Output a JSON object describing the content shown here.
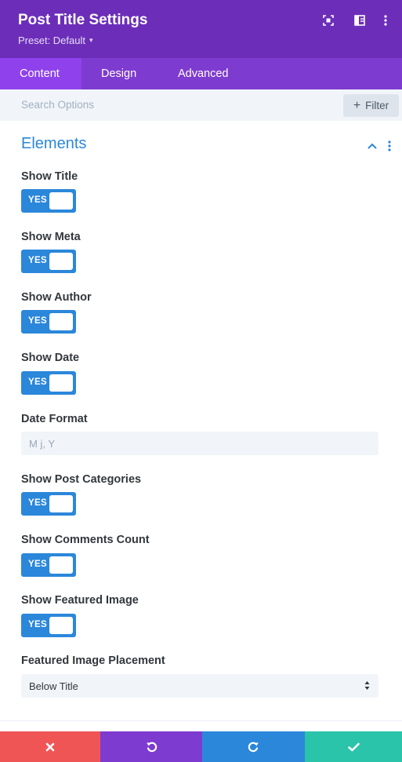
{
  "header": {
    "title": "Post Title Settings",
    "preset": "Preset: Default",
    "icons": [
      "expand-icon",
      "split-view-icon",
      "more-options-icon"
    ]
  },
  "tabs": [
    {
      "label": "Content",
      "active": true
    },
    {
      "label": "Design",
      "active": false
    },
    {
      "label": "Advanced",
      "active": false
    }
  ],
  "search": {
    "placeholder": "Search Options",
    "filter_label": "Filter"
  },
  "section": {
    "title": "Elements"
  },
  "fields": {
    "show_title": {
      "label": "Show Title",
      "value": "YES"
    },
    "show_meta": {
      "label": "Show Meta",
      "value": "YES"
    },
    "show_author": {
      "label": "Show Author",
      "value": "YES"
    },
    "show_date": {
      "label": "Show Date",
      "value": "YES"
    },
    "date_format": {
      "label": "Date Format",
      "placeholder": "M j, Y"
    },
    "show_post_categories": {
      "label": "Show Post Categories",
      "value": "YES"
    },
    "show_comments_count": {
      "label": "Show Comments Count",
      "value": "YES"
    },
    "show_featured_image": {
      "label": "Show Featured Image",
      "value": "YES"
    },
    "featured_image_placement": {
      "label": "Featured Image Placement",
      "value": "Below Title"
    }
  },
  "footer": [
    "cancel-icon",
    "undo-icon",
    "redo-icon",
    "save-check-icon"
  ],
  "colors": {
    "header": "#6c2eb9",
    "tabs": "#7e3bd0",
    "active_tab": "#8f42ec",
    "toggle_on": "#2b87da",
    "cancel": "#ef5555",
    "undo": "#7e3bd0",
    "redo": "#2b87da",
    "save": "#29c4a9"
  }
}
